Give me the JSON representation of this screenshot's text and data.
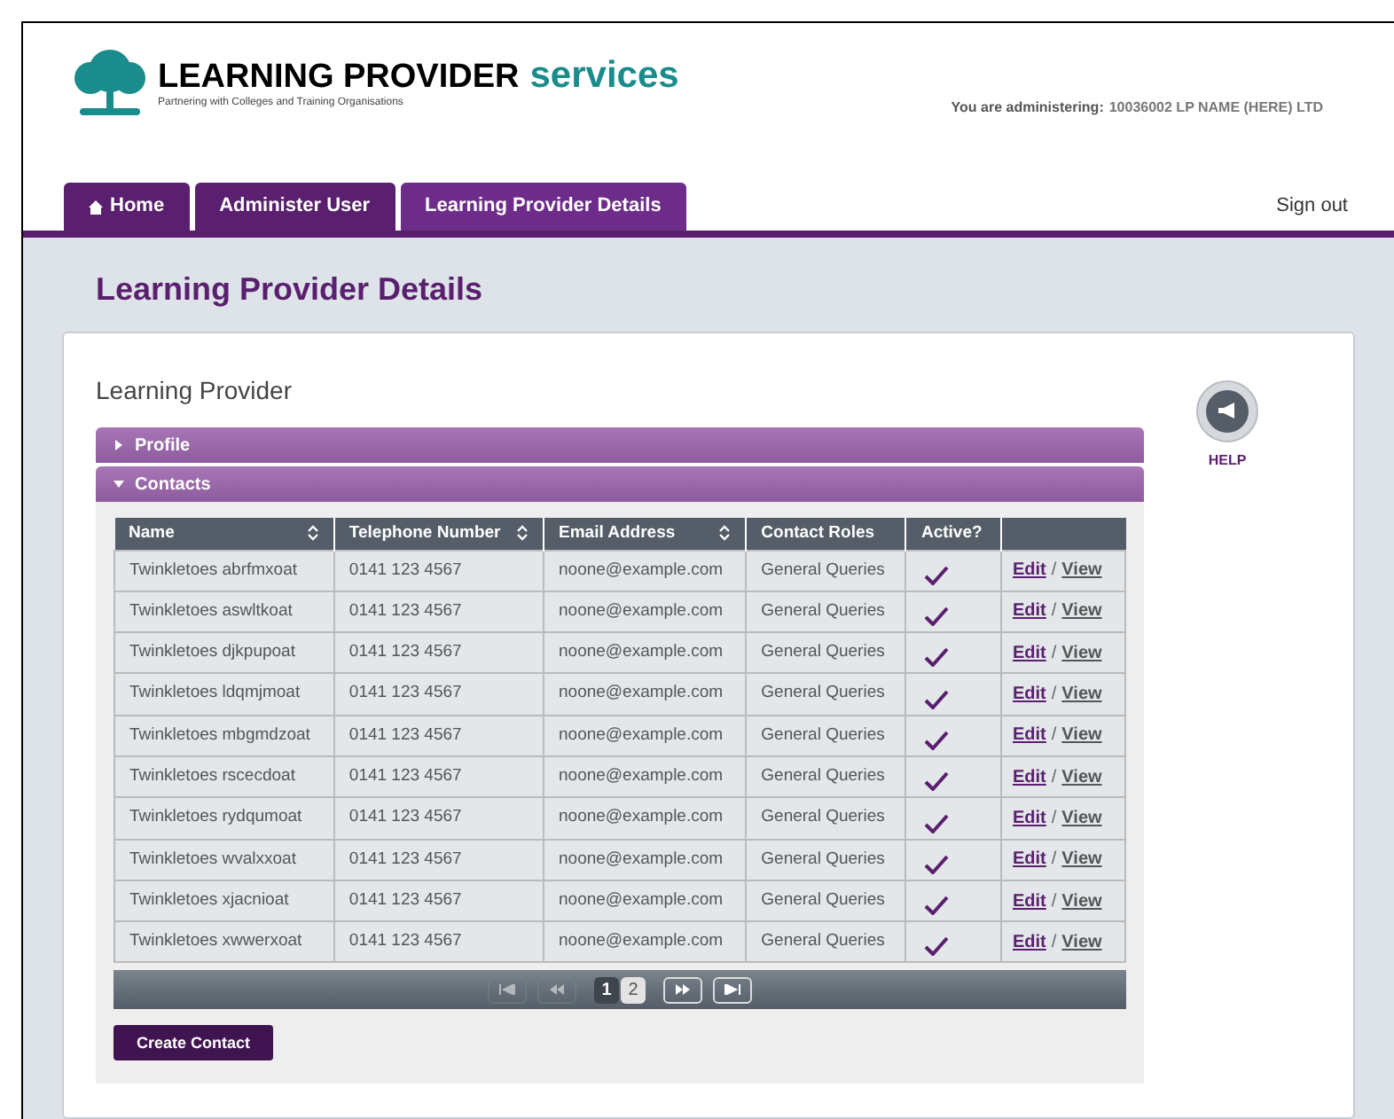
{
  "logo": {
    "title": "LEARNING PROVIDER",
    "accent": "services",
    "tagline": "Partnering with Colleges and Training Organisations"
  },
  "administering": {
    "label": "You are administering:",
    "value": "10036002 LP NAME (HERE) LTD"
  },
  "tabs": [
    {
      "label": "Home",
      "kind": "home",
      "selected": false
    },
    {
      "label": "Administer User",
      "selected": false
    },
    {
      "label": "Learning Provider Details",
      "selected": true
    }
  ],
  "sign_out": "Sign out",
  "page_title": "Learning Provider Details",
  "section_title": "Learning Provider",
  "help": "HELP",
  "panels": [
    {
      "label": "Profile",
      "expanded": false
    },
    {
      "label": "Contacts",
      "expanded": true
    }
  ],
  "table": {
    "columns": [
      {
        "label": "Name",
        "sortable": true
      },
      {
        "label": "Telephone Number",
        "sortable": true
      },
      {
        "label": "Email Address",
        "sortable": true
      },
      {
        "label": "Contact Roles",
        "sortable": false
      },
      {
        "label": "Active?",
        "sortable": false
      }
    ],
    "rows": [
      {
        "name": "Twinkletoes abrfmxoat",
        "phone": "0141 123 4567",
        "email": "noone@example.com",
        "roles": "General Queries",
        "active": true,
        "edit": "Edit",
        "sep": "/",
        "view": "View"
      },
      {
        "name": "Twinkletoes aswltkoat",
        "phone": "0141 123 4567",
        "email": "noone@example.com",
        "roles": "General Queries",
        "active": true,
        "edit": "Edit",
        "sep": "/",
        "view": "View"
      },
      {
        "name": "Twinkletoes djkpupoat",
        "phone": "0141 123 4567",
        "email": "noone@example.com",
        "roles": "General Queries",
        "active": true,
        "edit": "Edit",
        "sep": "/",
        "view": "View"
      },
      {
        "name": "Twinkletoes ldqmjmoat",
        "phone": "0141 123 4567",
        "email": "noone@example.com",
        "roles": "General Queries",
        "active": true,
        "edit": "Edit",
        "sep": "/",
        "view": "View"
      },
      {
        "name": "Twinkletoes mbgmdzoat",
        "phone": "0141 123 4567",
        "email": "noone@example.com",
        "roles": "General Queries",
        "active": true,
        "edit": "Edit",
        "sep": "/",
        "view": "View"
      },
      {
        "name": "Twinkletoes rscecdoat",
        "phone": "0141 123 4567",
        "email": "noone@example.com",
        "roles": "General Queries",
        "active": true,
        "edit": "Edit",
        "sep": "/",
        "view": "View"
      },
      {
        "name": "Twinkletoes rydqumoat",
        "phone": "0141 123 4567",
        "email": "noone@example.com",
        "roles": "General Queries",
        "active": true,
        "edit": "Edit",
        "sep": "/",
        "view": "View"
      },
      {
        "name": "Twinkletoes wvalxxoat",
        "phone": "0141 123 4567",
        "email": "noone@example.com",
        "roles": "General Queries",
        "active": true,
        "edit": "Edit",
        "sep": "/",
        "view": "View"
      },
      {
        "name": "Twinkletoes xjacnioat",
        "phone": "0141 123 4567",
        "email": "noone@example.com",
        "roles": "General Queries",
        "active": true,
        "edit": "Edit",
        "sep": "/",
        "view": "View"
      },
      {
        "name": "Twinkletoes xwwerxoat",
        "phone": "0141 123 4567",
        "email": "noone@example.com",
        "roles": "General Queries",
        "active": true,
        "edit": "Edit",
        "sep": "/",
        "view": "View"
      }
    ]
  },
  "pagination": {
    "first_disabled": true,
    "prev_disabled": true,
    "next_disabled": false,
    "last_disabled": false,
    "pages": [
      {
        "label": "1",
        "selected": true
      },
      {
        "label": "2",
        "selected": false
      }
    ]
  },
  "create_button": "Create Contact"
}
